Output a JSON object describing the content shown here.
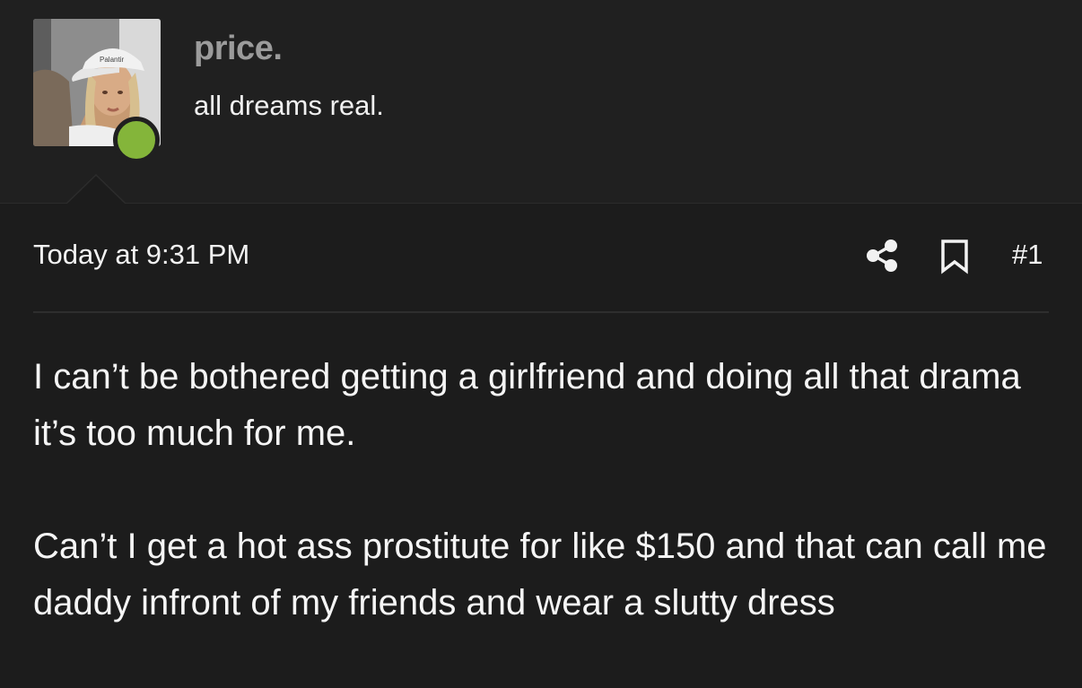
{
  "user": {
    "username": "price.",
    "title": "all dreams real.",
    "status": "online",
    "status_color": "#84b53a",
    "avatar_cap_text": "Palantir"
  },
  "post": {
    "timestamp": "Today at 9:31 PM",
    "number": "#1",
    "paragraphs": [
      "I can’t be bothered getting a girlfriend and doing all that drama it’s too much for me.",
      "Can’t I get a hot ass prostitute for like $150 and that can call me daddy infront of my friends and wear a slutty dress"
    ]
  },
  "icons": {
    "share": "share-icon",
    "bookmark": "bookmark-icon"
  },
  "colors": {
    "background": "#1c1c1c",
    "header_background": "#202020",
    "username": "#9b9b9b",
    "text": "#f2f2f2",
    "online": "#84b53a"
  }
}
